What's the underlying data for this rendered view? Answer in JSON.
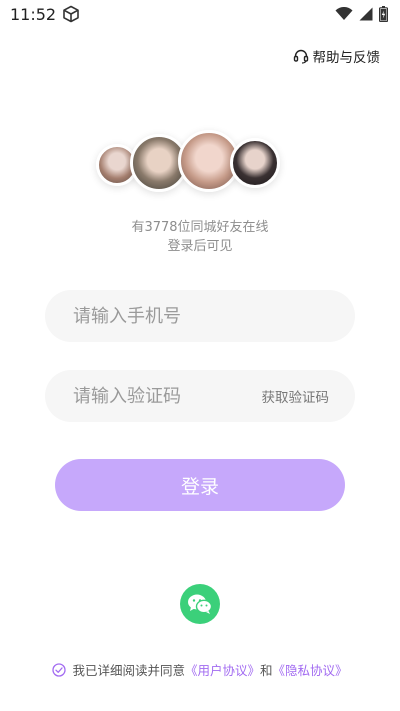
{
  "status_bar": {
    "time": "11:52"
  },
  "header": {
    "help_label": "帮助与反馈"
  },
  "online": {
    "line1": "有3778位同城好友在线",
    "line2": "登录后可见"
  },
  "form": {
    "phone_placeholder": "请输入手机号",
    "code_placeholder": "请输入验证码",
    "get_code_label": "获取验证码",
    "login_label": "登录"
  },
  "agreement": {
    "prefix": "我已详细阅读并同意",
    "user_agreement": "《用户协议》",
    "and": "和",
    "privacy_agreement": "《隐私协议》"
  },
  "icons": {
    "status": [
      "cube-icon",
      "wifi-icon",
      "signal-icon",
      "battery-icon"
    ],
    "help": "headset-icon",
    "social": "wechat-icon",
    "agree": "check-circle-icon"
  },
  "colors": {
    "accent": "#c6a8fb",
    "link": "#a26bf1",
    "wechat": "#3bd07a",
    "input_bg": "#f6f6f6"
  }
}
